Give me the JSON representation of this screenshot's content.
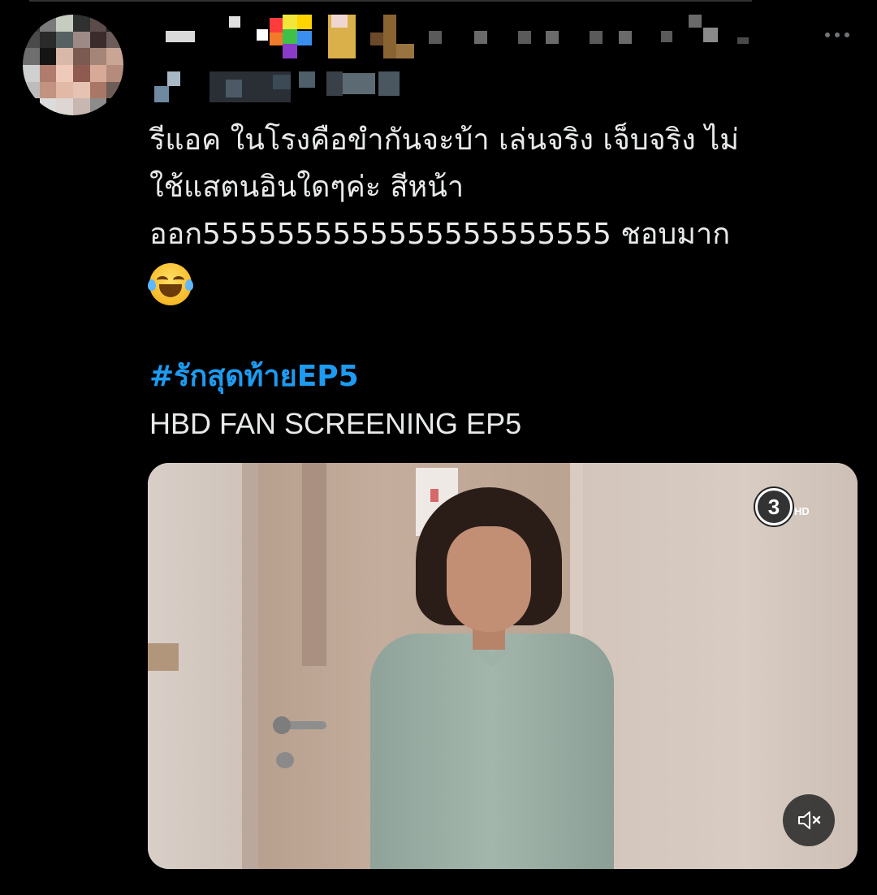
{
  "tweet": {
    "text_lines": [
      "รีแอค ในโรงคือขำกันจะบ้า เล่นจริง เจ็บจริง ไม่",
      "ใช้แสตนอินใดๆค่ะ สีหน้า",
      "ออก5555555555555555555555 ชอบมาก"
    ],
    "emoji": "face-with-tears-of-joy",
    "hashtag": "#รักสุดท้ายEP5",
    "subtitle": "HBD FAN SCREENING EP5"
  },
  "video": {
    "channel_logo_number": "3",
    "channel_logo_suffix": "HD",
    "muted": true
  },
  "colors": {
    "background": "#000000",
    "text": "#e7e9ea",
    "hashtag": "#1d9bf0",
    "secondary": "#71767b"
  },
  "icons": [
    "more-options-icon",
    "mute-icon"
  ]
}
